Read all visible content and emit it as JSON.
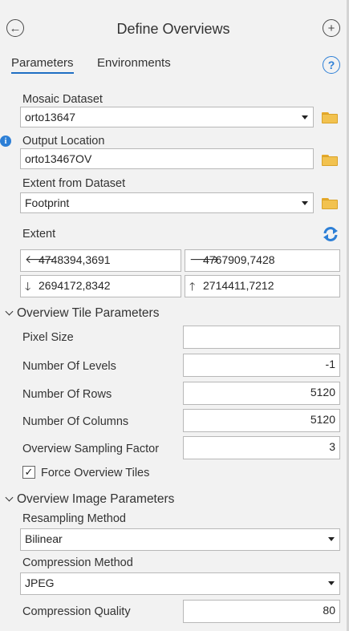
{
  "header": {
    "title": "Define Overviews",
    "back_glyph": "←",
    "add_glyph": "+"
  },
  "tabs": [
    {
      "label": "Parameters",
      "active": true
    },
    {
      "label": "Environments",
      "active": false
    }
  ],
  "help_glyph": "?",
  "params": {
    "mosaic_dataset": {
      "label": "Mosaic Dataset",
      "value": "orto13647"
    },
    "output_location": {
      "label": "Output Location",
      "value": "orto13467OV"
    },
    "extent_from_dataset": {
      "label": "Extent from Dataset",
      "value": "Footprint"
    },
    "extent": {
      "label": "Extent",
      "left": "4748394,3691",
      "right": "4767909,7428",
      "bottom": "2694172,8342",
      "top": "2714411,7212"
    }
  },
  "tile_section": {
    "header": "Overview Tile Parameters",
    "pixel_size": {
      "label": "Pixel Size",
      "value": ""
    },
    "levels": {
      "label": "Number Of Levels",
      "value": "-1"
    },
    "rows": {
      "label": "Number Of Rows",
      "value": "5120"
    },
    "columns": {
      "label": "Number Of Columns",
      "value": "5120"
    },
    "sampling": {
      "label": "Overview Sampling Factor",
      "value": "3"
    },
    "force_tiles": {
      "label": "Force Overview Tiles",
      "checked": true
    }
  },
  "image_section": {
    "header": "Overview Image Parameters",
    "resampling": {
      "label": "Resampling Method",
      "value": "Bilinear"
    },
    "compression": {
      "label": "Compression Method",
      "value": "JPEG"
    },
    "quality": {
      "label": "Compression Quality",
      "value": "80"
    }
  },
  "icons": {
    "left_arrow": "🡐",
    "right_arrow": "🡒",
    "down_arrow": "🡓",
    "up_arrow": "🡑",
    "info": "i",
    "check": "✓",
    "refresh_color": "#2d7fd6",
    "folder_color": "#f2c24f"
  }
}
